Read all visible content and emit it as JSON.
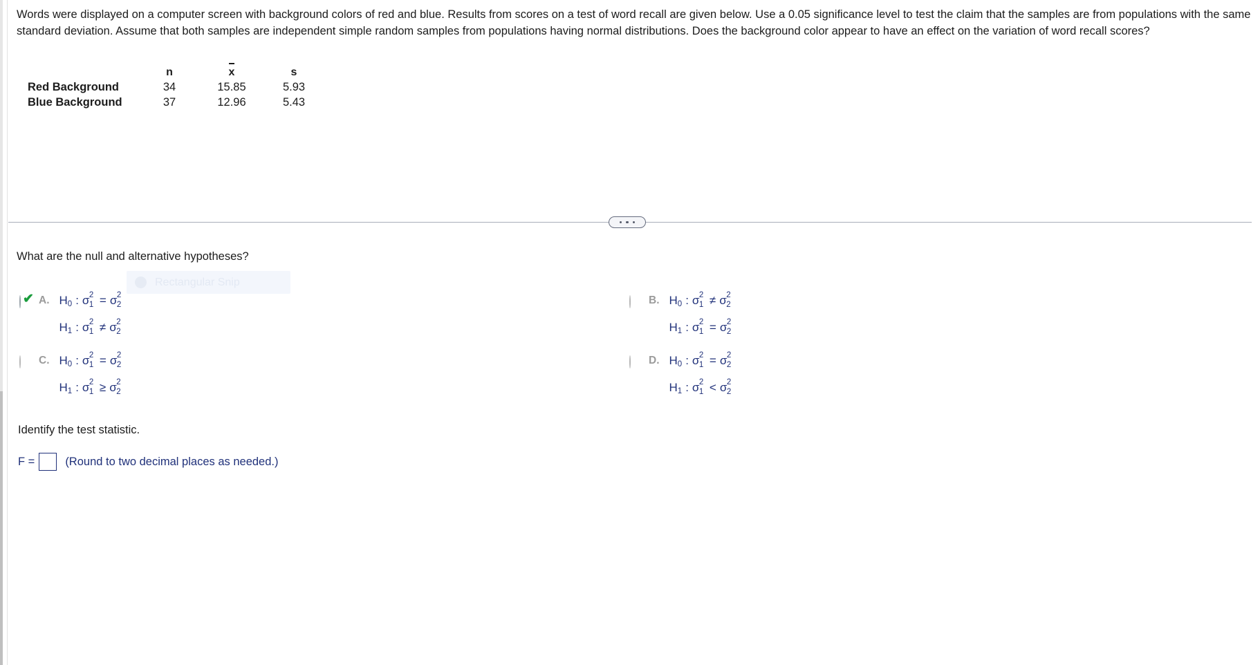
{
  "problem": {
    "statement": "Words were displayed on a computer screen with background colors of red and blue. Results from scores on a test of word recall are given below. Use a 0.05 significance level to test the claim that the samples are from populations with the same standard deviation. Assume that both samples are independent simple random samples from populations having normal distributions. Does the background color appear to have an effect on the variation of word recall scores?"
  },
  "stats_table": {
    "headers": [
      "",
      "n",
      "x",
      "s"
    ],
    "rows": [
      {
        "label": "Red Background",
        "n": "34",
        "xbar": "15.85",
        "s": "5.93"
      },
      {
        "label": "Blue Background",
        "n": "37",
        "xbar": "12.96",
        "s": "5.43"
      }
    ]
  },
  "splitter": {
    "handle_icon": "three-dots-handle"
  },
  "question": {
    "prompt": "What are the null and alternative hypotheses?"
  },
  "watermark": {
    "label": "Rectangular Snip",
    "icon": "snip-circle-icon"
  },
  "choices": [
    {
      "letter": "A.",
      "selected": true,
      "h0": {
        "prefix": "H",
        "sub": "0",
        "sigma1": "σ",
        "op": "=",
        "sigma2": "σ"
      },
      "h1": {
        "prefix": "H",
        "sub": "1",
        "sigma1": "σ",
        "op": "≠",
        "sigma2": "σ"
      }
    },
    {
      "letter": "B.",
      "selected": false,
      "h0": {
        "prefix": "H",
        "sub": "0",
        "sigma1": "σ",
        "op": "≠",
        "sigma2": "σ"
      },
      "h1": {
        "prefix": "H",
        "sub": "1",
        "sigma1": "σ",
        "op": "=",
        "sigma2": "σ"
      }
    },
    {
      "letter": "C.",
      "selected": false,
      "h0": {
        "prefix": "H",
        "sub": "0",
        "sigma1": "σ",
        "op": "=",
        "sigma2": "σ"
      },
      "h1": {
        "prefix": "H",
        "sub": "1",
        "sigma1": "σ",
        "op": "≥",
        "sigma2": "σ"
      }
    },
    {
      "letter": "D.",
      "selected": false,
      "h0": {
        "prefix": "H",
        "sub": "0",
        "sigma1": "σ",
        "op": "=",
        "sigma2": "σ"
      },
      "h1": {
        "prefix": "H",
        "sub": "1",
        "sigma1": "σ",
        "op": "<",
        "sigma2": "σ"
      }
    }
  ],
  "test_statistic": {
    "prompt": "Identify the test statistic.",
    "f_label": "F =",
    "f_value": "",
    "f_placeholder": "",
    "rounding_note": "(Round to two decimal places as needed.)"
  },
  "colors": {
    "math_blue": "#20317a",
    "check_green": "#1a9c3c",
    "letter_gray": "#9b9b9b",
    "splitter_gray": "#a8adb8"
  }
}
